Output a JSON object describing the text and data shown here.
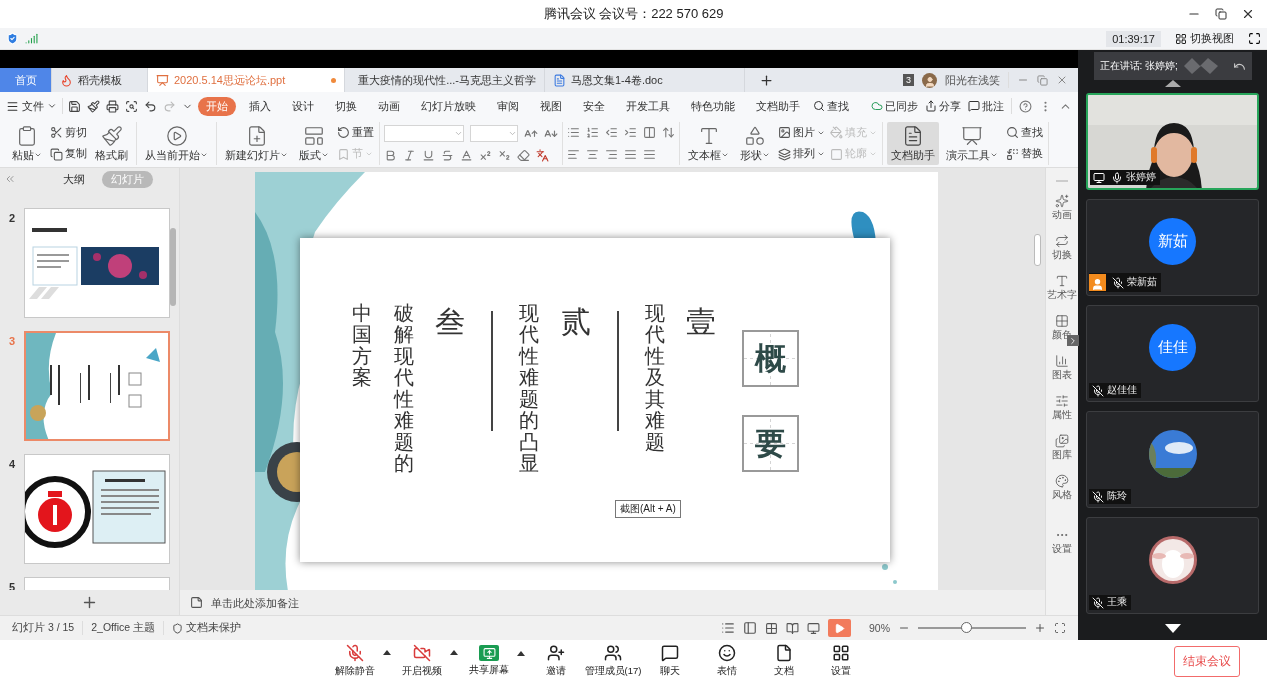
{
  "meeting": {
    "title": "腾讯会议 会议号：222 570 629",
    "timer": "01:39:17",
    "view_button": "切换视图"
  },
  "wps": {
    "tabs": [
      {
        "label": "首页",
        "kind": "home",
        "selected": false,
        "unsaved": false
      },
      {
        "label": "稻壳模板",
        "kind": "docer",
        "selected": false,
        "unsaved": false
      },
      {
        "label": "2020.5.14思远论坛.ppt",
        "kind": "ppt",
        "selected": true,
        "unsaved": true
      },
      {
        "label": "重大疫情的现代性...-马克思主义哲学",
        "kind": "doc",
        "selected": false,
        "unsaved": false
      },
      {
        "label": "马恩文集1-4卷.doc",
        "kind": "doc",
        "selected": false,
        "unsaved": false
      }
    ],
    "window_count": "3",
    "user": "阳光在浅笑",
    "file_menu": "文件",
    "menu": [
      {
        "label": "开始",
        "selected": true
      },
      {
        "label": "插入",
        "selected": false
      },
      {
        "label": "设计",
        "selected": false
      },
      {
        "label": "切换",
        "selected": false
      },
      {
        "label": "动画",
        "selected": false
      },
      {
        "label": "幻灯片放映",
        "selected": false
      },
      {
        "label": "审阅",
        "selected": false
      },
      {
        "label": "视图",
        "selected": false
      },
      {
        "label": "安全",
        "selected": false
      },
      {
        "label": "开发工具",
        "selected": false
      },
      {
        "label": "特色功能",
        "selected": false
      },
      {
        "label": "文档助手",
        "selected": false
      }
    ],
    "search": "查找",
    "menu_right": [
      "已同步",
      "分享",
      "批注"
    ],
    "ribbon": [
      {
        "kind": "items",
        "items": [
          {
            "label": "粘贴",
            "kind": "large",
            "caret": true,
            "disabled": false,
            "pressed": false
          },
          {
            "label": "剪切",
            "kind": "small",
            "caret": false,
            "disabled": false,
            "pressed": false
          },
          {
            "label": "复制",
            "kind": "small",
            "caret": false,
            "disabled": false,
            "pressed": false
          },
          {
            "label": "格式刷",
            "kind": "large",
            "caret": false,
            "disabled": false,
            "pressed": false
          }
        ]
      },
      {
        "kind": "items",
        "items": [
          {
            "label": "从当前开始",
            "kind": "large",
            "caret": true,
            "disabled": false,
            "pressed": false
          }
        ]
      },
      {
        "kind": "items",
        "items": [
          {
            "label": "新建幻灯片",
            "kind": "large",
            "caret": true,
            "disabled": false,
            "pressed": false
          },
          {
            "label": "版式",
            "kind": "large",
            "caret": true,
            "disabled": false,
            "pressed": false
          },
          {
            "label": "重置",
            "kind": "small",
            "caret": false,
            "disabled": false,
            "pressed": false
          },
          {
            "label": "节",
            "kind": "small",
            "caret": true,
            "disabled": true,
            "pressed": false
          }
        ]
      },
      {
        "kind": "font"
      },
      {
        "kind": "paragraph"
      },
      {
        "kind": "items",
        "items": [
          {
            "label": "文本框",
            "kind": "large",
            "caret": true,
            "disabled": false,
            "pressed": false
          },
          {
            "label": "形状",
            "kind": "large",
            "caret": true,
            "disabled": false,
            "pressed": false
          },
          {
            "label": "图片",
            "kind": "small",
            "caret": true,
            "disabled": false,
            "pressed": false
          },
          {
            "label": "排列",
            "kind": "small",
            "caret": true,
            "disabled": false,
            "pressed": false
          },
          {
            "label": "填充",
            "kind": "small",
            "caret": true,
            "disabled": true,
            "pressed": false
          },
          {
            "label": "轮廓",
            "kind": "small",
            "caret": true,
            "disabled": true,
            "pressed": false
          }
        ]
      },
      {
        "kind": "items",
        "items": [
          {
            "label": "文档助手",
            "kind": "large",
            "caret": false,
            "disabled": false,
            "pressed": true
          },
          {
            "label": "演示工具",
            "kind": "large",
            "caret": true,
            "disabled": false,
            "pressed": false
          },
          {
            "label": "查找",
            "kind": "small",
            "caret": false,
            "disabled": false,
            "pressed": false
          },
          {
            "label": "替换",
            "kind": "small",
            "caret": false,
            "disabled": false,
            "pressed": false
          }
        ]
      }
    ],
    "panel_tabs": [
      {
        "label": "大纲",
        "selected": false
      },
      {
        "label": "幻灯片",
        "selected": true
      }
    ],
    "slides": [
      {
        "number": "2",
        "selected": false
      },
      {
        "number": "3",
        "selected": true
      },
      {
        "number": "4",
        "selected": false
      },
      {
        "number": "5",
        "selected": false
      }
    ],
    "slide": {
      "heading": [
        "概",
        "要"
      ],
      "sections": [
        {
          "numeral": "叁",
          "lines": [
            "中国方案",
            "破解现代性难题的"
          ]
        },
        {
          "numeral": "贰",
          "lines": [
            "现代性难题的凸显"
          ]
        },
        {
          "numeral": "壹",
          "lines": [
            "现代性及其难题"
          ]
        }
      ]
    },
    "tooltip": "截图(Alt + A)",
    "notes_placeholder": "单击此处添加备注",
    "side_tools": [
      "动画",
      "切换",
      "艺术字",
      "颜色",
      "图表",
      "属性",
      "图库",
      "风格",
      "设置"
    ],
    "status": {
      "slide": "幻灯片 3 / 15",
      "theme": "2_Office 主题",
      "protection": "文档未保护",
      "zoom": "90%",
      "level": 0.44
    }
  },
  "participants": {
    "speaking": "正在讲话: 张婷婷;",
    "people": [
      {
        "name": "张婷婷",
        "kind": "video",
        "muted": false,
        "host": false,
        "speaking": true
      },
      {
        "name": "荣新茹",
        "kind": "initials",
        "initials": "新茹",
        "muted": true,
        "host": true,
        "speaking": false
      },
      {
        "name": "赵佳佳",
        "kind": "initials",
        "initials": "佳佳",
        "muted": true,
        "host": false,
        "speaking": false
      },
      {
        "name": "陈玲",
        "muted": true,
        "host": false,
        "speaking": false
      },
      {
        "name": "王乘",
        "muted": true,
        "host": false,
        "speaking": false
      }
    ]
  },
  "toolbar": [
    {
      "label": "解除静音",
      "menu": true
    },
    {
      "label": "开启视频",
      "menu": true
    },
    {
      "label": "共享屏幕",
      "menu": true
    },
    {
      "label": "邀请",
      "menu": false
    },
    {
      "label": "管理成员(17)",
      "menu": false
    },
    {
      "label": "聊天",
      "menu": false
    },
    {
      "label": "表情",
      "menu": false
    },
    {
      "label": "文档",
      "menu": false
    },
    {
      "label": "设置",
      "menu": false
    }
  ],
  "end_button": "结束会议"
}
